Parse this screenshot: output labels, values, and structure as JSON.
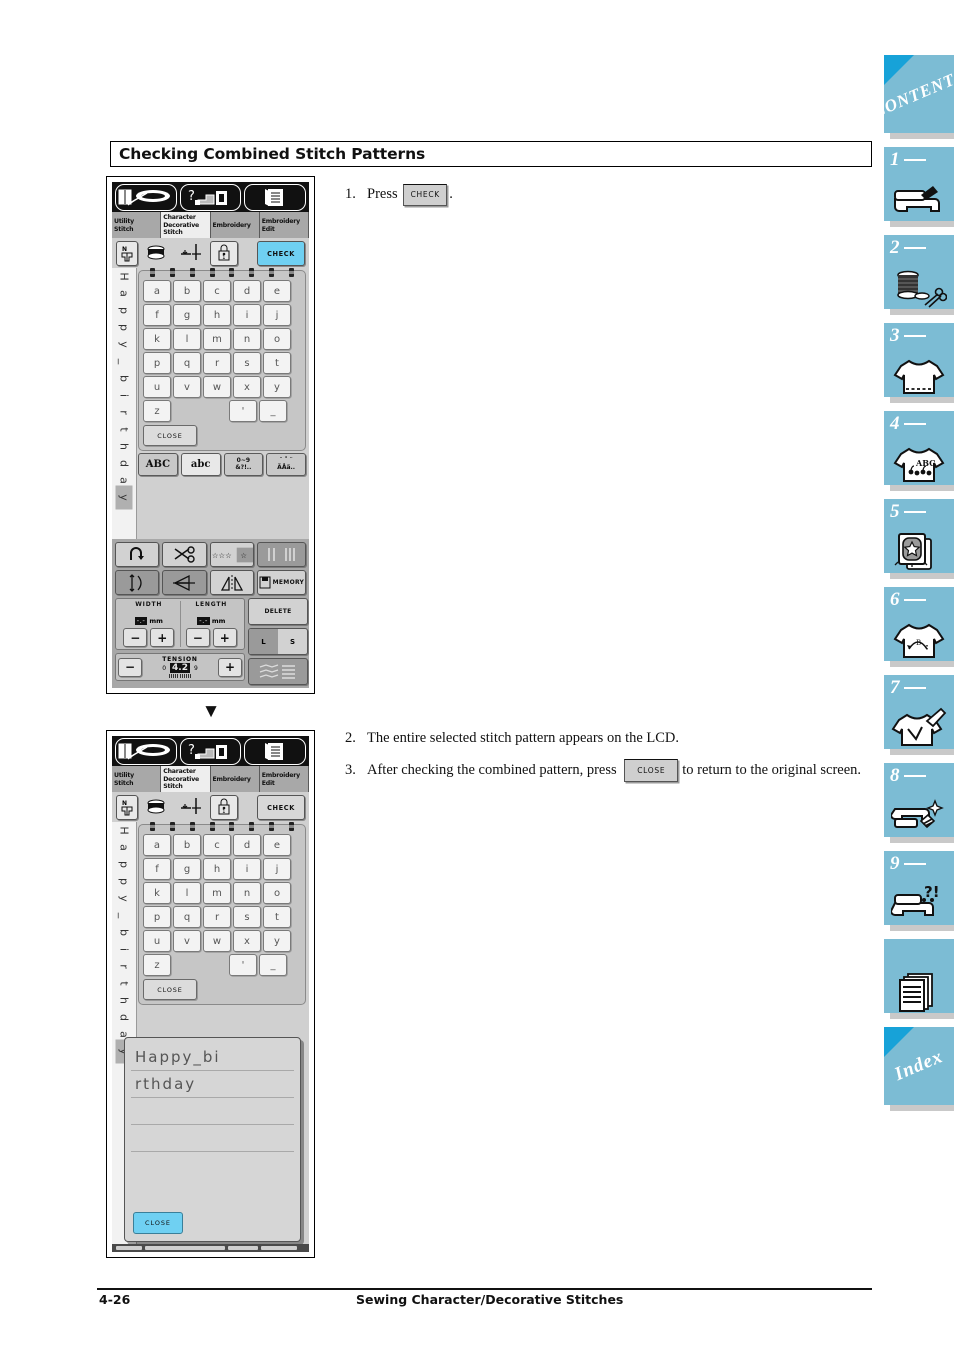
{
  "section": {
    "heading": "Checking Combined Stitch Patterns"
  },
  "steps": {
    "step1": {
      "num": "1.",
      "pre": "Press",
      "button": "CHECK",
      "post": "."
    },
    "step2": {
      "num": "2.",
      "text": "The entire selected stitch pattern appears on the LCD."
    },
    "step3": {
      "num": "3.",
      "pre": "After checking the combined pattern, press",
      "button": "CLOSE",
      "post": "to return to the original screen."
    }
  },
  "lcd": {
    "top_icons": [
      "book-needle-icon",
      "question-machine-icon",
      "document-list-icon"
    ],
    "tabs": [
      {
        "label": "Utility\nStitch",
        "line1": "Utility",
        "line2": "Stitch",
        "line3": "",
        "active": false
      },
      {
        "label": "Character Decorative Stitch",
        "line1": "Character",
        "line2": "Decorative",
        "line3": "Stitch",
        "active": true
      },
      {
        "label": "Embroidery",
        "line1": "Embroidery",
        "line2": "",
        "line3": "",
        "active": false
      },
      {
        "label": "Embroidery Edit",
        "line1": "Embroidery",
        "line2": "Edit",
        "line3": "",
        "active": false
      }
    ],
    "utility_icons": [
      "presser-foot-n-icon",
      "bobbin-icon",
      "needle-position-icon",
      "lock-key-icon"
    ],
    "check_label": "CHECK",
    "preview_text": "Happy_birthday",
    "keyboard_rows": [
      [
        "a",
        "b",
        "c",
        "d",
        "e"
      ],
      [
        "f",
        "g",
        "h",
        "i",
        "j"
      ],
      [
        "k",
        "l",
        "m",
        "n",
        "o"
      ],
      [
        "p",
        "q",
        "r",
        "s",
        "t"
      ],
      [
        "u",
        "v",
        "w",
        "x",
        "y"
      ],
      [
        "z",
        "",
        "",
        "'",
        "_"
      ]
    ],
    "close_label": "CLOSE",
    "charset_buttons": [
      {
        "label": "ABC",
        "type": "text",
        "active": false
      },
      {
        "label": "abc",
        "type": "text",
        "active": true
      },
      {
        "label": "0~9 &?!..",
        "type": "stack",
        "line1": "0~9",
        "line2": "&?!..",
        "active": false
      },
      {
        "label": "ÄÅä..",
        "type": "stack",
        "line1": "¨ ˚ ¨",
        "line2": "ÄÅä..",
        "active": false
      }
    ],
    "function_buttons_row1": [
      "reverse-stitch-icon",
      "thread-cutter-icon",
      "stipple-stitch-icon",
      "twin-needle-icon"
    ],
    "function_buttons_row2": [
      "elongation-icon",
      "horizontal-mirror-icon",
      "vertical-mirror-icon",
      "memory-icon"
    ],
    "memory_label": "MEMORY",
    "delete_label": "DELETE",
    "size_buttons": {
      "large": "L",
      "small": "S",
      "selected": "L"
    },
    "width": {
      "title": "WIDTH",
      "value": "-.-",
      "unit": "mm",
      "minus": "−",
      "plus": "+"
    },
    "length": {
      "title": "LENGTH",
      "value": "-.-",
      "unit": "mm",
      "minus": "−",
      "plus": "+"
    },
    "tension": {
      "title": "TENSION",
      "value": "4.2",
      "min": "0",
      "max": "9",
      "minus": "−",
      "plus": "+"
    }
  },
  "popup": {
    "lines": [
      "Happy_bi",
      "rthday",
      "",
      "",
      ""
    ],
    "close_label": "CLOSE"
  },
  "side_tabs": [
    {
      "id": "contents",
      "kind": "corner",
      "label": "CONTENTS",
      "number": ""
    },
    {
      "id": "chapter-1",
      "kind": "num",
      "number": "1",
      "icon": "sewing-machine-icon"
    },
    {
      "id": "chapter-2",
      "kind": "num",
      "number": "2",
      "icon": "thread-spool-scissors-icon"
    },
    {
      "id": "chapter-3",
      "kind": "num",
      "number": "3",
      "icon": "tshirt-stitch-icon"
    },
    {
      "id": "chapter-4",
      "kind": "num",
      "number": "4",
      "icon": "tshirt-abc-icon"
    },
    {
      "id": "chapter-5",
      "kind": "num",
      "number": "5",
      "icon": "embroidery-card-star-icon"
    },
    {
      "id": "chapter-6",
      "kind": "num",
      "number": "6",
      "icon": "tshirt-monogram-icon"
    },
    {
      "id": "chapter-7",
      "kind": "num",
      "number": "7",
      "icon": "tshirt-pen-icon"
    },
    {
      "id": "chapter-8",
      "kind": "num",
      "number": "8",
      "icon": "machine-maintenance-icon"
    },
    {
      "id": "chapter-9",
      "kind": "num",
      "number": "9",
      "icon": "machine-troubleshoot-icon"
    },
    {
      "id": "appendix",
      "kind": "plain",
      "number": "",
      "icon": "stacked-pages-icon"
    },
    {
      "id": "index",
      "kind": "corner",
      "label": "Index",
      "number": ""
    }
  ],
  "footer": {
    "page": "4-26",
    "title": "Sewing Character/Decorative Stitches"
  },
  "colors": {
    "tab_blue": "#7cbcd4",
    "corner_blue": "#17a2d8",
    "highlight_cyan": "#6fd0f2",
    "lcd_gray": "#d0d0d0",
    "shadow_gray": "#c9c9c9"
  }
}
